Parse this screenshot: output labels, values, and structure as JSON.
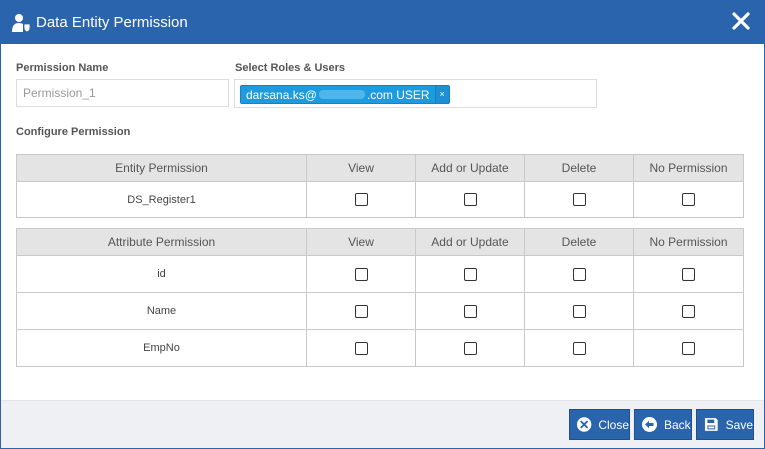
{
  "dialog": {
    "title": "Data Entity Permission"
  },
  "form": {
    "permission_name_label": "Permission Name",
    "permission_name_value": "Permission_1",
    "roles_label": "Select Roles & Users",
    "role_chip_prefix": "darsana.ks@",
    "role_chip_suffix": ".com USER",
    "role_chip_remove": "×",
    "configure_label": "Configure Permission"
  },
  "entity_table": {
    "headers": [
      "Entity Permission",
      "View",
      "Add or Update",
      "Delete",
      "No Permission"
    ],
    "rows": [
      "DS_Register1"
    ]
  },
  "attribute_table": {
    "headers": [
      "Attribute Permission",
      "View",
      "Add or Update",
      "Delete",
      "No Permission"
    ],
    "rows": [
      "id",
      "Name",
      "EmpNo"
    ]
  },
  "footer": {
    "close_label": "Close",
    "back_label": "Back",
    "save_label": "Save"
  },
  "colors": {
    "header_bg": "#2a64ad",
    "chip_bg": "#1d9be0",
    "table_header_bg": "#e4e4e4",
    "footer_bg": "#eef0f3"
  },
  "icons": {
    "title": "user-shield-icon",
    "close": "close-icon",
    "close_button": "times-circle-icon",
    "back_button": "arrow-left-circle-icon",
    "save_button": "floppy-disk-icon"
  }
}
